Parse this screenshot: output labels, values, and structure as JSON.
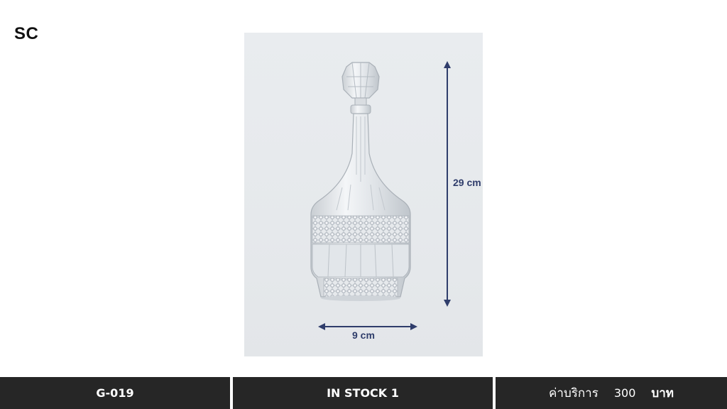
{
  "brand": {
    "logo_text": "SC"
  },
  "product_image": {
    "alt": "Glass decanter",
    "height_label": "29 cm",
    "width_label": "9 cm",
    "dimension_color": "#2f3d6b"
  },
  "footer": {
    "code": "G-019",
    "stock_text": "IN STOCK 1",
    "price_label": "ค่าบริการ",
    "price_value": "300",
    "price_unit": "บาท"
  }
}
